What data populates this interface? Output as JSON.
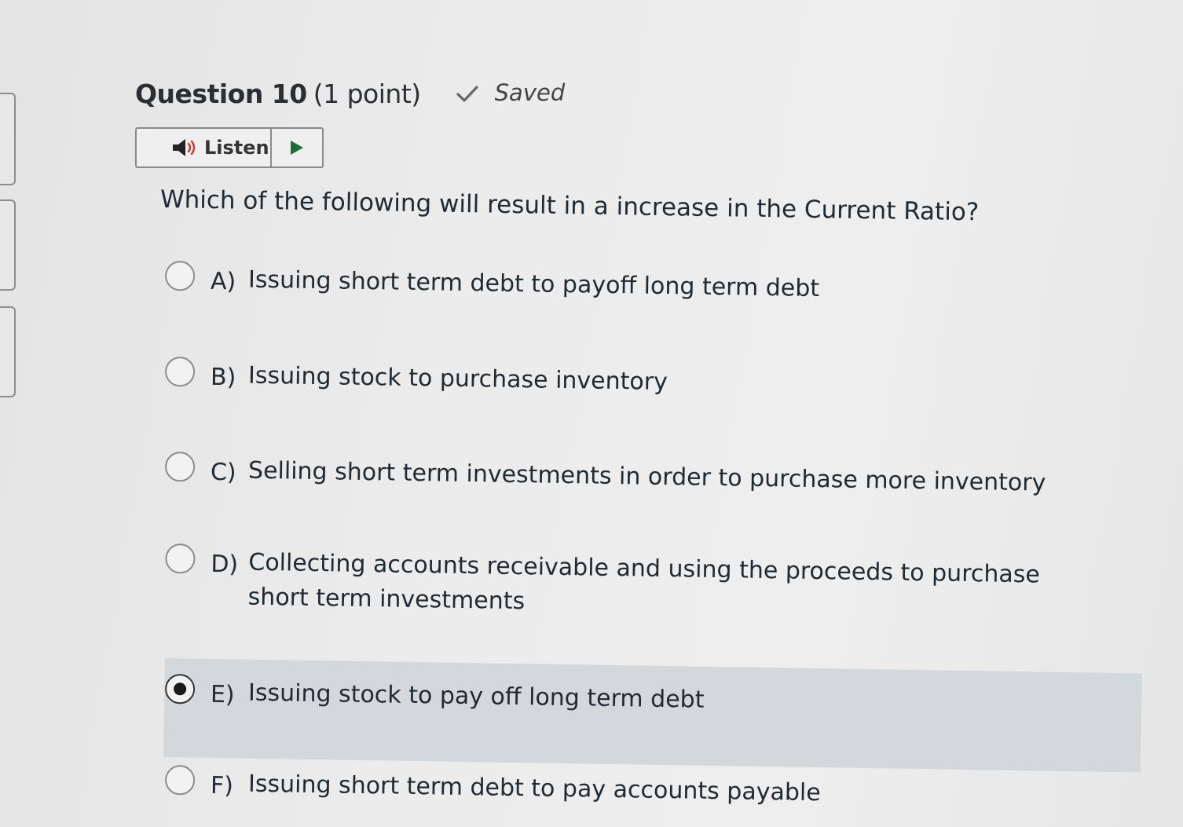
{
  "header": {
    "title": "Question 10",
    "points": "(1 point)",
    "status_icon": "checkmark-icon",
    "status": "Saved"
  },
  "listen": {
    "label": "Listen",
    "icon": "speaker-icon",
    "play_icon": "play-icon"
  },
  "question": {
    "text": "Which of the following will result in a increase in the Current Ratio?"
  },
  "options": [
    {
      "letter": "A)",
      "text": "Issuing short term debt to payoff long term debt",
      "selected": false
    },
    {
      "letter": "B)",
      "text": "Issuing stock to purchase inventory",
      "selected": false
    },
    {
      "letter": "C)",
      "text": "Selling short term investments in order to purchase more inventory",
      "selected": false
    },
    {
      "letter": "D)",
      "text": "Collecting accounts receivable and using the proceeds to purchase short term investments",
      "selected": false
    },
    {
      "letter": "E)",
      "text": "Issuing stock to pay off long term debt",
      "selected": true
    },
    {
      "letter": "F)",
      "text": "Issuing short term debt to pay accounts payable",
      "selected": false
    }
  ],
  "colors": {
    "selected_highlight": "#d3d8dd",
    "text": "#1f2a33"
  }
}
